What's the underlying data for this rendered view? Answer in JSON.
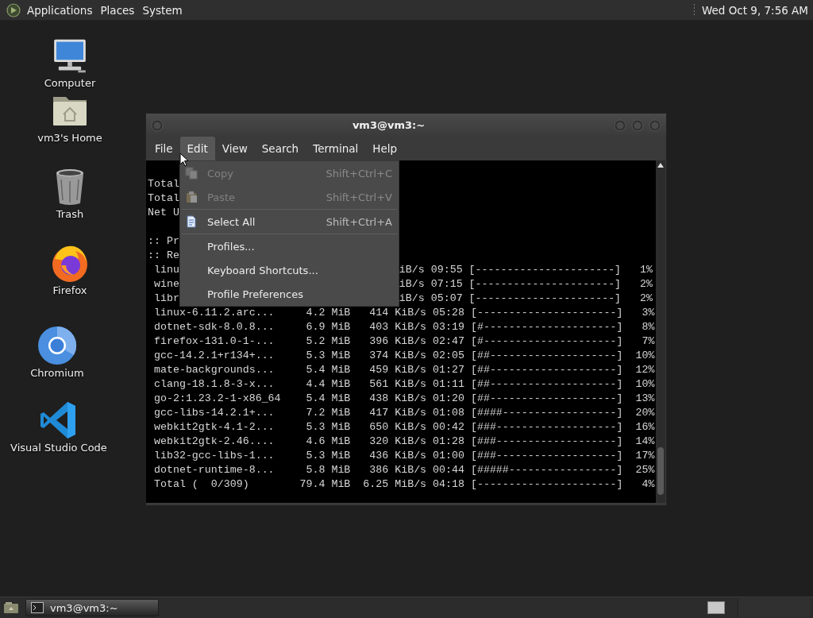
{
  "top_panel": {
    "menus": [
      "Applications",
      "Places",
      "System"
    ],
    "clock": "Wed Oct  9, 7:56 AM"
  },
  "desktop_icons": [
    {
      "label": "Computer",
      "kind": "computer"
    },
    {
      "label": "vm3's Home",
      "kind": "home"
    },
    {
      "label": "Trash",
      "kind": "trash"
    },
    {
      "label": "Firefox",
      "kind": "firefox"
    },
    {
      "label": "Chromium",
      "kind": "chromium"
    },
    {
      "label": "Visual Studio Code",
      "kind": "vscode"
    }
  ],
  "terminal_window": {
    "title": "vm3@vm3:~",
    "menu_bar": [
      {
        "label": "File",
        "selected": false
      },
      {
        "label": "Edit",
        "selected": true
      },
      {
        "label": "View",
        "selected": false
      },
      {
        "label": "Search",
        "selected": false
      },
      {
        "label": "Terminal",
        "selected": false
      },
      {
        "label": "Help",
        "selected": false
      }
    ],
    "summary_lines": [
      {
        "left": "Total"
      },
      {
        "left": "Total"
      },
      {
        "left": "Net U"
      }
    ],
    "lines": [
      {
        "left": ":: Pr"
      },
      {
        "left": ":: Re"
      },
      {
        "left": " linu",
        "right": "iB/s 09:55 [----------------------]   1%"
      },
      {
        "left": " wine",
        "right": "iB/s 07:15 [----------------------]   2%"
      },
      {
        "left": " libr",
        "right": "iB/s 05:07 [----------------------]   2%"
      },
      {
        "left": " linux-6.11.2.arc...     4.2 MiB   414 KiB/s 05:28 [----------------------]   3%"
      },
      {
        "left": " dotnet-sdk-8.0.8...     6.9 MiB   403 KiB/s 03:19 [#---------------------]   8%"
      },
      {
        "left": " firefox-131.0-1-...     5.2 MiB   396 KiB/s 02:47 [#---------------------]   7%"
      },
      {
        "left": " gcc-14.2.1+r134+...     5.3 MiB   374 KiB/s 02:05 [##--------------------]  10%"
      },
      {
        "left": " mate-backgrounds...     5.4 MiB   459 KiB/s 01:27 [##--------------------]  12%"
      },
      {
        "left": " clang-18.1.8-3-x...     4.4 MiB   561 KiB/s 01:11 [##--------------------]  10%"
      },
      {
        "left": " go-2:1.23.2-1-x86_64    5.4 MiB   438 KiB/s 01:20 [##--------------------]  13%"
      },
      {
        "left": " gcc-libs-14.2.1+...     7.2 MiB   417 KiB/s 01:08 [####------------------]  20%"
      },
      {
        "left": " webkit2gtk-4.1-2...     5.3 MiB   650 KiB/s 00:42 [###-------------------]  16%"
      },
      {
        "left": " webkit2gtk-2.46....     4.6 MiB   320 KiB/s 01:28 [###-------------------]  14%"
      },
      {
        "left": " lib32-gcc-libs-1...     5.3 MiB   436 KiB/s 01:00 [###-------------------]  17%"
      },
      {
        "left": " dotnet-runtime-8...     5.8 MiB   386 KiB/s 00:44 [#####-----------------]  25%"
      },
      {
        "left": " Total (  0/309)        79.4 MiB  6.25 MiB/s 04:18 [----------------------]   4%"
      }
    ],
    "edit_menu": [
      {
        "kind": "copy",
        "label": "Copy",
        "shortcut": "Shift+Ctrl+C",
        "disabled": true
      },
      {
        "kind": "paste",
        "label": "Paste",
        "shortcut": "Shift+Ctrl+V",
        "disabled": true
      },
      {
        "kind": "separator"
      },
      {
        "kind": "select",
        "label": "Select All",
        "shortcut": "Shift+Ctrl+A",
        "disabled": false
      },
      {
        "kind": "separator"
      },
      {
        "kind": "plain",
        "label": "Profiles...",
        "disabled": false
      },
      {
        "kind": "plain",
        "label": "Keyboard Shortcuts...",
        "disabled": false
      },
      {
        "kind": "plain",
        "label": "Profile Preferences",
        "disabled": false
      }
    ]
  },
  "taskbar": {
    "tasks": [
      {
        "label": "vm3@vm3:~",
        "selected": true
      }
    ]
  }
}
